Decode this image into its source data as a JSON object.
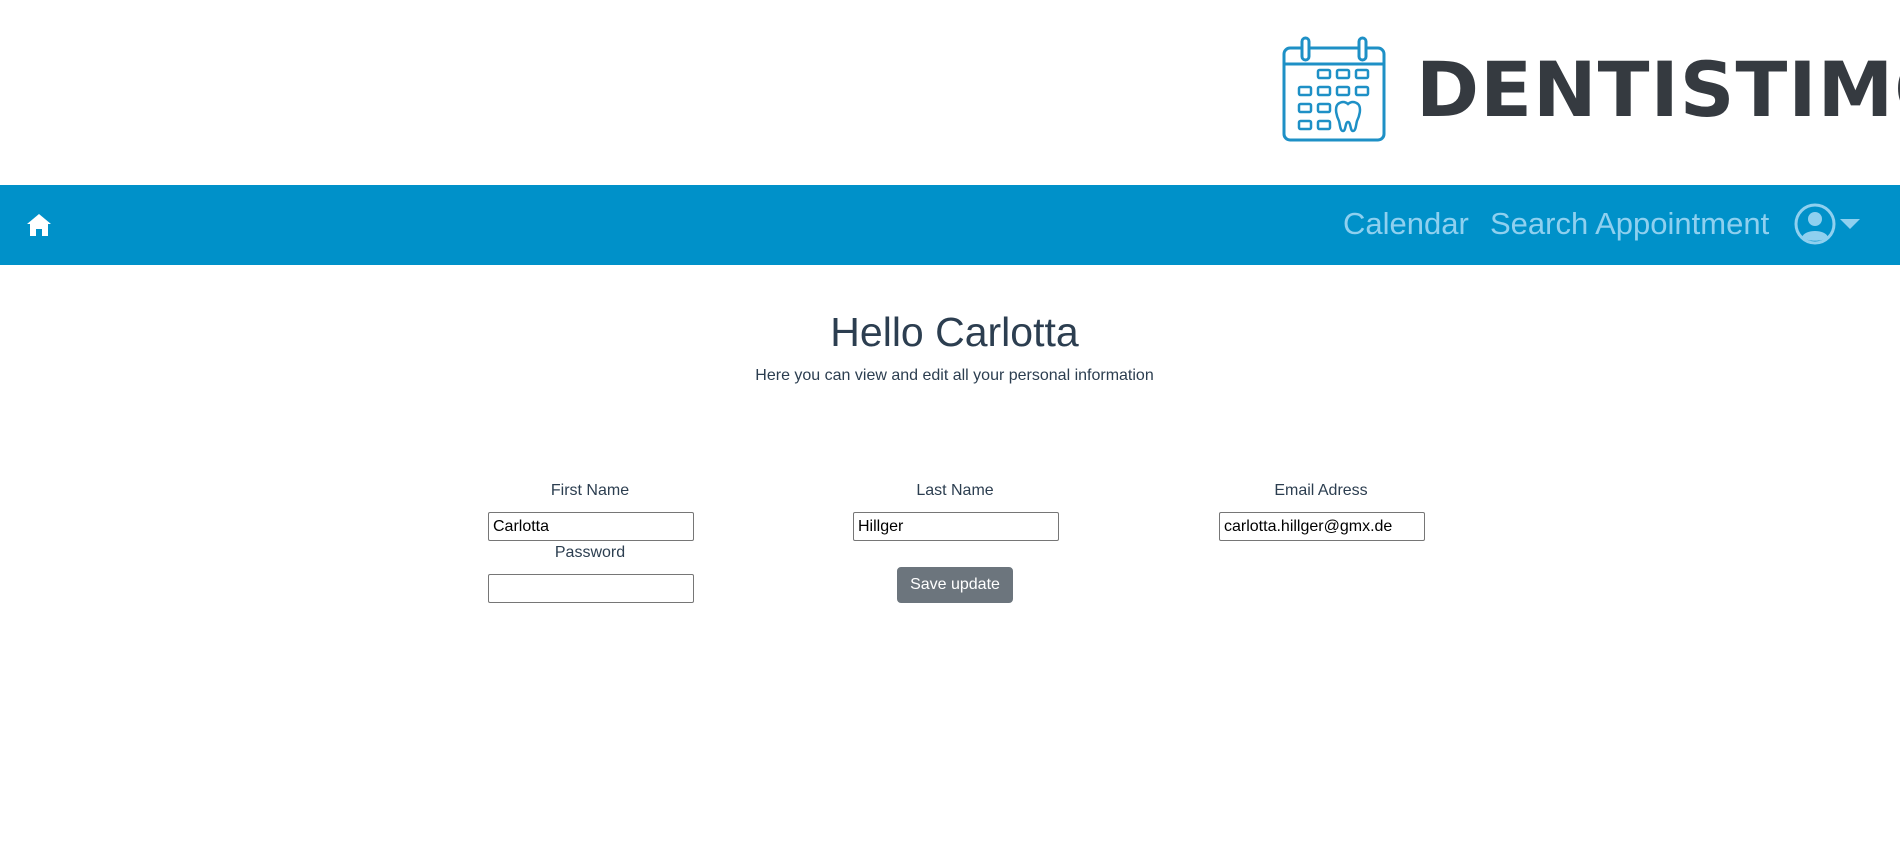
{
  "app": {
    "brand_name": "DENTISTIMO",
    "brand_color": "#0091c9",
    "logo_icon": "calendar-tooth-icon"
  },
  "nav": {
    "home_icon": "home-icon",
    "links": [
      "Calendar",
      "Search Appointment"
    ],
    "user_icon": "user-circle-icon",
    "dropdown_icon": "caret-down-icon",
    "bar_color": "#0091c9",
    "link_color": "#8fd0ef"
  },
  "profile": {
    "greeting": "Hello Carlotta",
    "subtitle": "Here you can view and edit all your personal information",
    "fields": {
      "first_name": {
        "label": "First Name",
        "value": "Carlotta"
      },
      "last_name": {
        "label": "Last Name",
        "value": "Hillger"
      },
      "email": {
        "label": "Email Adress",
        "value": "carlotta.hillger@gmx.de"
      },
      "password": {
        "label": "Password",
        "value": ""
      }
    },
    "save_label": "Save update"
  }
}
